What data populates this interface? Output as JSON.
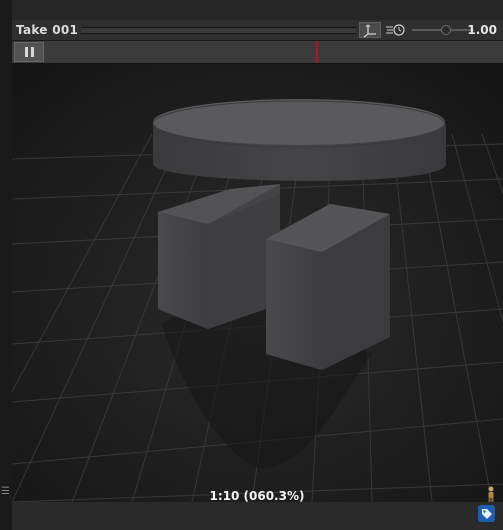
{
  "header": {
    "take_name": "Take 001",
    "speed_value": "1.00",
    "speed_fraction": 0.55
  },
  "timeline": {
    "playhead_fraction": 0.62
  },
  "viewport": {
    "status_text": "1:10 (060.3%)"
  },
  "icons": {
    "pause": "pause-icon",
    "axes": "axes-icon",
    "speed": "playback-speed-icon",
    "avatar": "avatar-figure-icon",
    "tag": "tag-icon",
    "grip": "grip-icon"
  },
  "colors": {
    "playhead": "#b01818",
    "tag_badge": "#1c5fb2"
  }
}
